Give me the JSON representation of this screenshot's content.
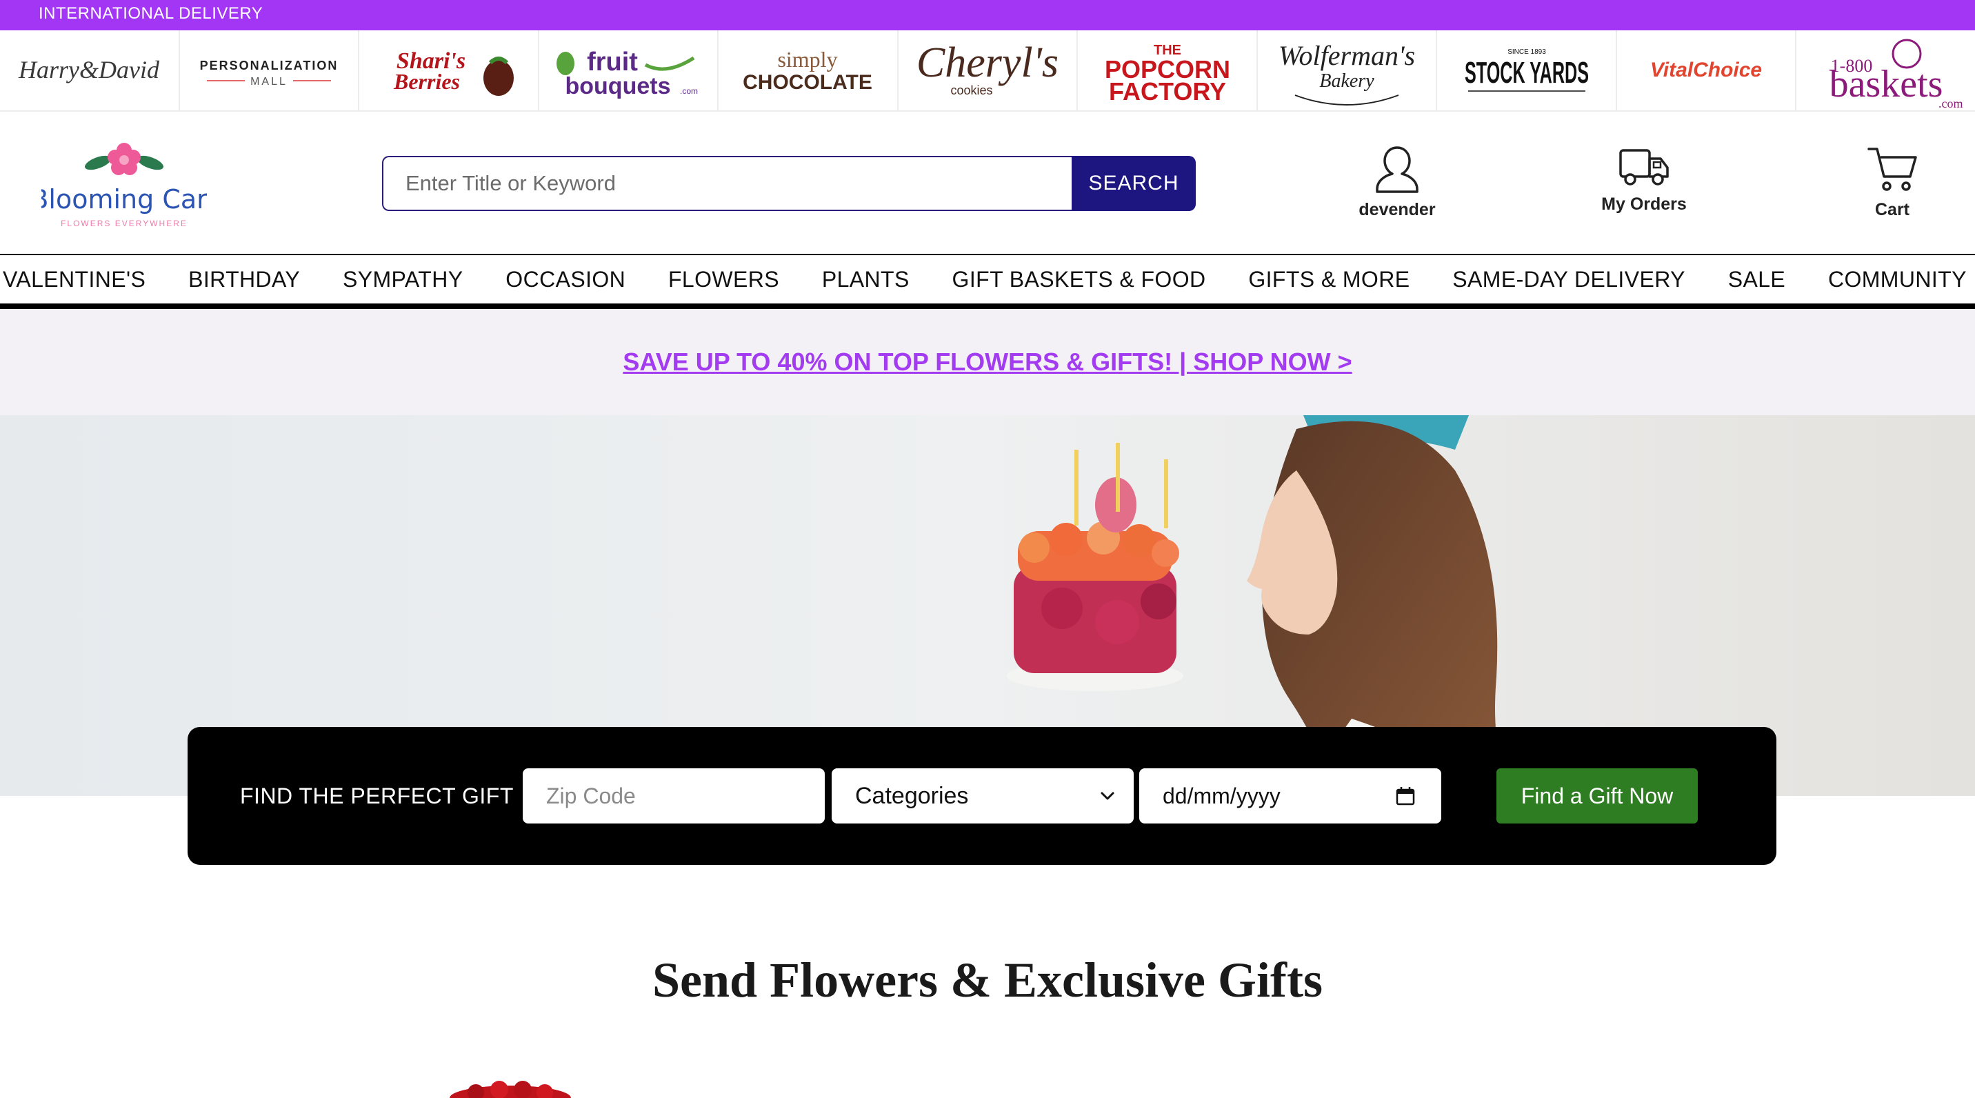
{
  "topbar": {
    "label": "INTERNATIONAL DELIVERY"
  },
  "brands": [
    {
      "name": "Harry&David",
      "color": "#3a3a3a"
    },
    {
      "name_line1": "PERSONALIZATION",
      "name_line2": "MALL",
      "color": "#222222"
    },
    {
      "name_line1": "Shari's",
      "name_line2": "Berries",
      "color": "#b3151b"
    },
    {
      "name_line1": "fruit",
      "name_line2": "bouquets",
      "suffix": ".com",
      "color": "#5a2a86"
    },
    {
      "name_line1": "simply",
      "name_line2": "CHOCOLATE",
      "color": "#4a2b1c"
    },
    {
      "name": "Cheryl's",
      "sub": "cookies",
      "color": "#4a2a1e"
    },
    {
      "name_line1": "THE",
      "name_line2": "POPCORN",
      "name_line3": "FACTORY",
      "color": "#c8161d"
    },
    {
      "name_line1": "Wolferman's",
      "name_line2": "Bakery",
      "color": "#222222"
    },
    {
      "name": "STOCK YARDS",
      "top": "SINCE 1893",
      "color": "#111111"
    },
    {
      "name": "VitalChoice",
      "color": "#e2452f"
    },
    {
      "name_line1": "1-800",
      "name_line2": "baskets",
      "suffix": ".com",
      "color": "#8c1a7a"
    }
  ],
  "header": {
    "logo_name": "Blooming Cart",
    "logo_tagline": "FLOWERS EVERYWHERE",
    "search_placeholder": "Enter Title or Keyword",
    "search_button": "SEARCH",
    "account_label": "devender",
    "orders_label": "My Orders",
    "cart_label": "Cart"
  },
  "nav": [
    "VALENTINE'S",
    "BIRTHDAY",
    "SYMPATHY",
    "OCCASION",
    "FLOWERS",
    "PLANTS",
    "GIFT BASKETS & FOOD",
    "GIFTS & MORE",
    "SAME-DAY DELIVERY",
    "SALE",
    "COMMUNITY"
  ],
  "promo": {
    "text": "SAVE UP TO 40% ON TOP FLOWERS & GIFTS! | SHOP NOW >"
  },
  "finder": {
    "label": "FIND THE PERFECT GIFT",
    "zip_placeholder": "Zip Code",
    "category_value": "Categories",
    "date_placeholder": "dd/mm/yyyy",
    "button": "Find a Gift Now"
  },
  "section": {
    "title": "Send Flowers & Exclusive Gifts"
  },
  "colors": {
    "accent_purple": "#a335f5",
    "navy": "#1e1680",
    "green": "#2f7d22"
  }
}
